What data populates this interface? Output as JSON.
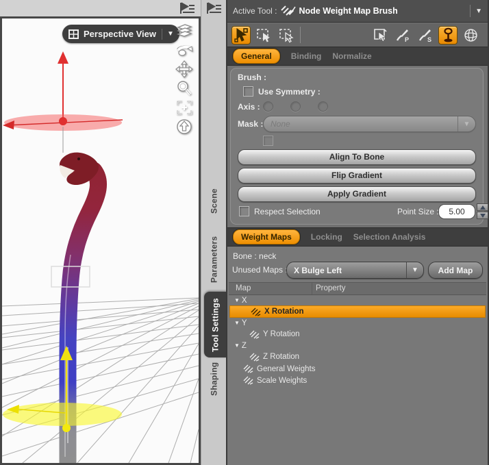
{
  "colors": {
    "accent_orange": "#F7941D",
    "selection_row": "#F29111",
    "panel_gray": "#717171",
    "dark_bar": "#3E3E3E",
    "gizmo_red": "#E03030",
    "gizmo_yellow": "#F0E615",
    "viewport_bg": "#FBFBFB"
  },
  "viewport": {
    "view_selector": {
      "label": "Perspective View",
      "icon": "window-grid-icon",
      "chevron": "▼"
    },
    "nav_icons": [
      "pane-options",
      "layers",
      "orbit",
      "pan",
      "zoom",
      "frame",
      "aim"
    ]
  },
  "sidebar": {
    "tabs": [
      {
        "label": "Scene",
        "active": false
      },
      {
        "label": "Parameters",
        "active": false
      },
      {
        "label": "Tool Settings",
        "active": true
      },
      {
        "label": "Shaping",
        "active": false
      }
    ]
  },
  "header": {
    "active_tool_label": "Active Tool :",
    "tool_name": "Node Weight Map Brush",
    "chevron": "▼"
  },
  "toolbar": {
    "icons": [
      "node-selection",
      "marquee-node-selection",
      "rect-node-selection",
      "geometry-selection",
      "paint-brush",
      "smooth-brush",
      "bone-gizmo",
      "gradient-sphere"
    ],
    "active_icons": [
      "node-selection",
      "bone-gizmo"
    ],
    "paint_brush_letter": "P",
    "smooth_brush_letter": "S"
  },
  "tool_tabs": [
    {
      "label": "General",
      "active": true
    },
    {
      "label": "Binding",
      "active": false
    },
    {
      "label": "Normalize",
      "active": false
    }
  ],
  "general": {
    "brush_label": "Brush :",
    "use_symmetry_label": "Use Symmetry :",
    "axis_label": "Axis :",
    "mask_label": "Mask :",
    "mask_value": "None",
    "buttons": [
      "Align To Bone",
      "Flip Gradient",
      "Apply Gradient"
    ],
    "respect_selection_label": "Respect Selection",
    "point_size_label": "Point Size :",
    "point_size_value": "5.00"
  },
  "weight_maps": {
    "tabs": [
      {
        "label": "Weight Maps",
        "active": true
      },
      {
        "label": "Locking",
        "active": false
      },
      {
        "label": "Selection Analysis",
        "active": false
      }
    ],
    "bone_label": "Bone : neck",
    "unused_maps_label": "Unused Maps :",
    "unused_maps_value": "X Bulge Left",
    "add_map_label": "Add Map",
    "columns": [
      "Map",
      "Property"
    ],
    "rows": [
      {
        "type": "group",
        "label": "X"
      },
      {
        "type": "map",
        "label": "X Rotation",
        "selected": true
      },
      {
        "type": "group",
        "label": "Y"
      },
      {
        "type": "map",
        "label": "Y Rotation",
        "selected": false
      },
      {
        "type": "group",
        "label": "Z"
      },
      {
        "type": "map",
        "label": "Z Rotation",
        "selected": false
      },
      {
        "type": "map-root",
        "label": "General Weights",
        "selected": false
      },
      {
        "type": "map-root",
        "label": "Scale Weights",
        "selected": false
      }
    ],
    "tri": "▼"
  }
}
